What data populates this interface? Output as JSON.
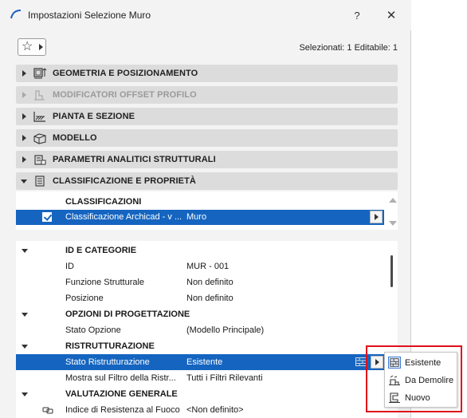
{
  "window": {
    "title": "Impostazioni Selezione Muro",
    "help_label": "?",
    "close_label": "✕"
  },
  "toolbar": {
    "favorites_icon": "star-icon",
    "selection_info": "Selezionati: 1 Editabile: 1"
  },
  "panels": [
    {
      "label": "GEOMETRIA E POSIZIONAMENTO",
      "icon": "geometry-icon",
      "expanded": false,
      "enabled": true
    },
    {
      "label": "MODIFICATORI OFFSET PROFILO",
      "icon": "profile-offset-icon",
      "expanded": false,
      "enabled": false
    },
    {
      "label": "PIANTA E SEZIONE",
      "icon": "floorplan-section-icon",
      "expanded": false,
      "enabled": true
    },
    {
      "label": "MODELLO",
      "icon": "model-icon",
      "expanded": false,
      "enabled": true
    },
    {
      "label": "PARAMETRI ANALITICI STRUTTURALI",
      "icon": "structural-analytics-icon",
      "expanded": false,
      "enabled": true
    },
    {
      "label": "CLASSIFICAZIONE E PROPRIETÀ",
      "icon": "classification-icon",
      "expanded": true,
      "enabled": true
    }
  ],
  "classification": {
    "header": "CLASSIFICAZIONI",
    "row": {
      "name": "Classificazione Archicad - v ...",
      "value": "Muro",
      "checked": true
    }
  },
  "properties": {
    "group_id": "ID E CATEGORIE",
    "id_key": "ID",
    "id_val": "MUR - 001",
    "funzione_key": "Funzione Strutturale",
    "funzione_val": "Non definito",
    "posizione_key": "Posizione",
    "posizione_val": "Non definito",
    "group_opzioni": "OPZIONI DI PROGETTAZIONE",
    "stato_opzione_key": "Stato Opzione",
    "stato_opzione_val": "(Modello Principale)",
    "group_ristrutturazione": "RISTRUTTURAZIONE",
    "stato_ristr_key": "Stato Ristrutturazione",
    "stato_ristr_val": "Esistente",
    "mostra_key": "Mostra sul Filtro della Ristr...",
    "mostra_val": "Tutti i Filtri Rilevanti",
    "group_valutazione": "VALUTAZIONE GENERALE",
    "fuoco_key": "Indice di Resistenza al Fuoco",
    "fuoco_val": "<Non definito>"
  },
  "renovation_menu": {
    "items": [
      {
        "label": "Esistente",
        "icon": "existing-wall-icon",
        "selected": true
      },
      {
        "label": "Da Demolire",
        "icon": "demolish-icon",
        "selected": false
      },
      {
        "label": "Nuovo",
        "icon": "new-construction-icon",
        "selected": false
      }
    ]
  },
  "colors": {
    "selection": "#1565c0",
    "panel_header": "#dcdcdc",
    "highlight_frame": "#e0101a"
  }
}
